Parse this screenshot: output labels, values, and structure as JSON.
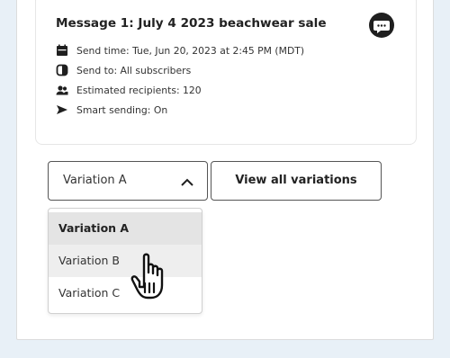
{
  "message_card": {
    "title": "Message 1: July 4 2023 beachwear sale",
    "icon": "chat-bubble-icon",
    "details": [
      {
        "icon": "calendar-icon",
        "text": "Send time: Tue, Jun 20, 2023 at 2:45 PM (MDT)"
      },
      {
        "icon": "contrast-icon",
        "text": "Send to: All subscribers"
      },
      {
        "icon": "people-icon",
        "text": "Estimated recipients: 120"
      },
      {
        "icon": "send-icon",
        "text": "Smart sending: On"
      }
    ]
  },
  "variation_select": {
    "selected": "Variation A",
    "state": "open",
    "options": [
      "Variation A",
      "Variation B",
      "Variation C"
    ],
    "hovered": "Variation B"
  },
  "view_all_button": {
    "label": "View all variations"
  },
  "cursor": {
    "type": "pointer-hand"
  },
  "colors": {
    "background": "#e8f0f7",
    "panel": "#ffffff",
    "selected_option": "#e4e4e4",
    "hover_option": "#eeeeee",
    "text": "#222222"
  }
}
